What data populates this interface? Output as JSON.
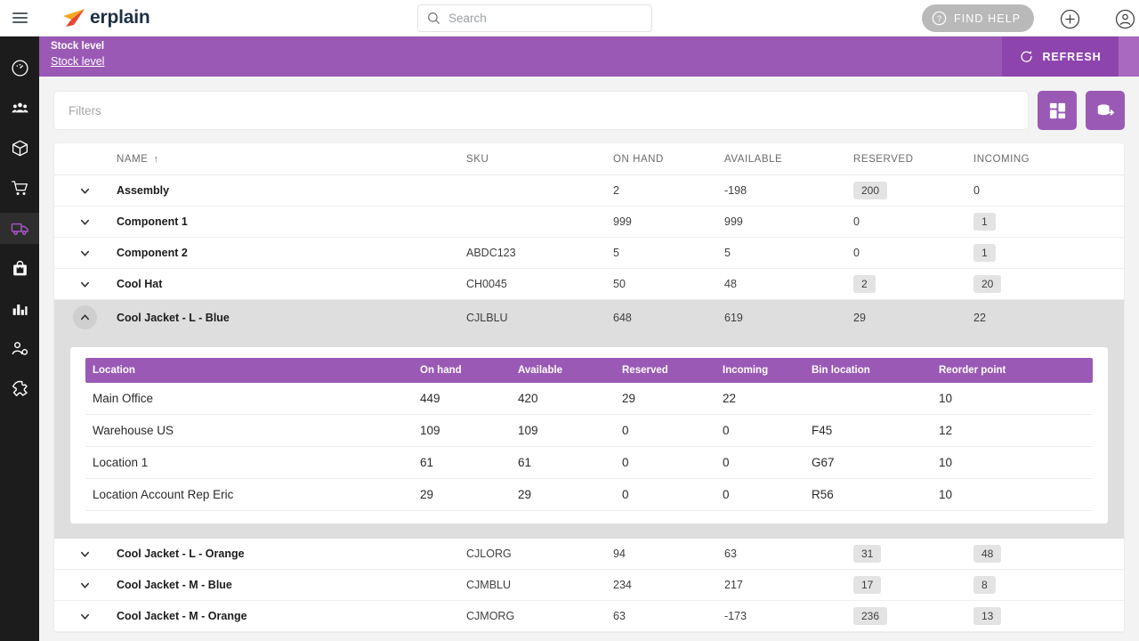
{
  "header": {
    "menu_icon": "hamburger-icon",
    "logo_text": "erplain",
    "search": {
      "placeholder": "Search",
      "value": "",
      "icon": "search-icon"
    },
    "find_help_label": "FIND HELP",
    "find_help_icon": "question-circle-icon",
    "add_icon": "plus-circle-icon",
    "account_icon": "user-circle-icon"
  },
  "banner": {
    "title": "Stock level",
    "breadcrumb": "Stock level",
    "refresh_label": "REFRESH",
    "refresh_icon": "refresh-icon",
    "color": "#9a59b5",
    "refresh_bg": "#8e44ad"
  },
  "sidebar": {
    "items": [
      {
        "name": "dashboard",
        "icon": "gauge-icon",
        "active": false
      },
      {
        "name": "customers",
        "icon": "people-icon",
        "active": false
      },
      {
        "name": "products",
        "icon": "box-icon",
        "active": false
      },
      {
        "name": "sales",
        "icon": "cart-icon",
        "active": false
      },
      {
        "name": "inventory",
        "icon": "truck-icon",
        "active": true
      },
      {
        "name": "purchasing",
        "icon": "bag-icon",
        "active": false
      },
      {
        "name": "reports",
        "icon": "bar-chart-icon",
        "active": false
      },
      {
        "name": "users",
        "icon": "user-settings-icon",
        "active": false
      },
      {
        "name": "integrations",
        "icon": "puzzle-icon",
        "active": false
      }
    ],
    "active_color": "#a855c8"
  },
  "toolbar": {
    "filters_placeholder": "Filters",
    "filters_value": "",
    "columns_icon": "grid-layout-icon",
    "export_icon": "database-export-icon",
    "button_color": "#9a59b5"
  },
  "table": {
    "columns": [
      "NAME",
      "SKU",
      "ON HAND",
      "AVAILABLE",
      "RESERVED",
      "INCOMING"
    ],
    "sort_column": "NAME",
    "sort_arrow": "↑",
    "rows": [
      {
        "expanded": false,
        "chevron": "chevron-down-icon",
        "name": "Assembly",
        "sku": "",
        "on_hand": "2",
        "available": "-198",
        "reserved": "200",
        "reserved_badge": true,
        "incoming": "0",
        "incoming_badge": false
      },
      {
        "expanded": false,
        "chevron": "chevron-down-icon",
        "name": "Component 1",
        "sku": "",
        "on_hand": "999",
        "available": "999",
        "reserved": "0",
        "reserved_badge": false,
        "incoming": "1",
        "incoming_badge": true
      },
      {
        "expanded": false,
        "chevron": "chevron-down-icon",
        "name": "Component 2",
        "sku": "ABDC123",
        "on_hand": "5",
        "available": "5",
        "reserved": "0",
        "reserved_badge": false,
        "incoming": "1",
        "incoming_badge": true
      },
      {
        "expanded": false,
        "chevron": "chevron-down-icon",
        "name": "Cool Hat",
        "sku": "CH0045",
        "on_hand": "50",
        "available": "48",
        "reserved": "2",
        "reserved_badge": true,
        "incoming": "20",
        "incoming_badge": true
      },
      {
        "expanded": true,
        "chevron": "chevron-up-icon",
        "name": "Cool Jacket - L - Blue",
        "sku": "CJLBLU",
        "on_hand": "648",
        "available": "619",
        "reserved": "29",
        "reserved_badge": false,
        "incoming": "22",
        "incoming_badge": false
      },
      {
        "expanded": false,
        "chevron": "chevron-down-icon",
        "name": "Cool Jacket - L - Orange",
        "sku": "CJLORG",
        "on_hand": "94",
        "available": "63",
        "reserved": "31",
        "reserved_badge": true,
        "incoming": "48",
        "incoming_badge": true
      },
      {
        "expanded": false,
        "chevron": "chevron-down-icon",
        "name": "Cool Jacket - M - Blue",
        "sku": "CJMBLU",
        "on_hand": "234",
        "available": "217",
        "reserved": "17",
        "reserved_badge": true,
        "incoming": "8",
        "incoming_badge": true
      },
      {
        "expanded": false,
        "chevron": "chevron-down-icon",
        "name": "Cool Jacket - M - Orange",
        "sku": "CJMORG",
        "on_hand": "63",
        "available": "-173",
        "reserved": "236",
        "reserved_badge": true,
        "incoming": "13",
        "incoming_badge": true
      }
    ]
  },
  "detail": {
    "columns": [
      "Location",
      "On hand",
      "Available",
      "Reserved",
      "Incoming",
      "Bin location",
      "Reorder point"
    ],
    "header_color": "#9a59b5",
    "rows": [
      {
        "location": "Main Office",
        "on_hand": "449",
        "available": "420",
        "reserved": "29",
        "incoming": "22",
        "bin": "",
        "reorder": "10"
      },
      {
        "location": "Warehouse US",
        "on_hand": "109",
        "available": "109",
        "reserved": "0",
        "incoming": "0",
        "bin": "F45",
        "reorder": "12"
      },
      {
        "location": "Location 1",
        "on_hand": "61",
        "available": "61",
        "reserved": "0",
        "incoming": "0",
        "bin": "G67",
        "reorder": "10"
      },
      {
        "location": "Location Account Rep Eric",
        "on_hand": "29",
        "available": "29",
        "reserved": "0",
        "incoming": "0",
        "bin": "R56",
        "reorder": "10"
      }
    ]
  }
}
